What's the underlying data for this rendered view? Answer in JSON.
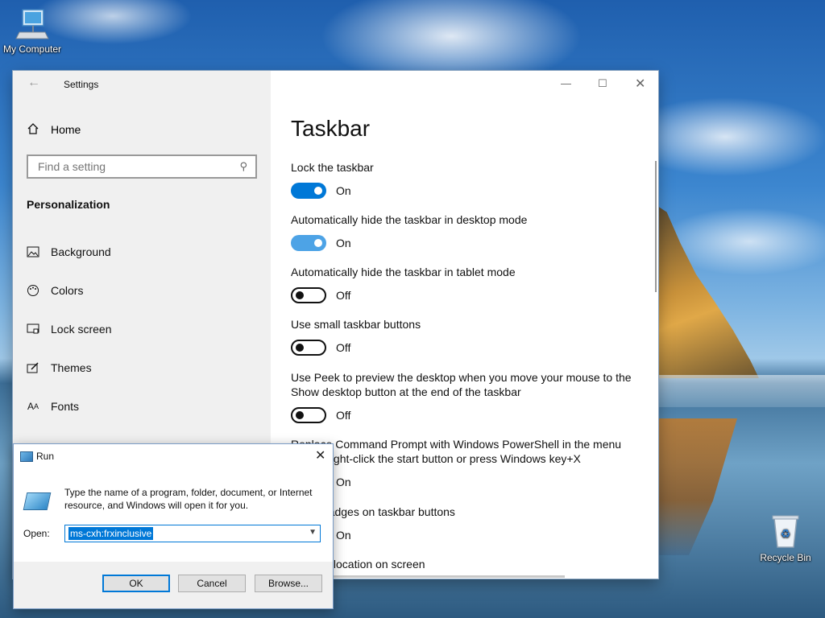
{
  "desktop": {
    "icons": [
      {
        "label": "My Computer",
        "icon": "computer-icon"
      },
      {
        "label": "Recycle Bin",
        "icon": "recycle-bin-icon"
      }
    ]
  },
  "settings": {
    "window_title": "Settings",
    "home_label": "Home",
    "search_placeholder": "Find a setting",
    "section_label": "Personalization",
    "nav_items": [
      {
        "label": "Background",
        "icon": "image-icon"
      },
      {
        "label": "Colors",
        "icon": "palette-icon"
      },
      {
        "label": "Lock screen",
        "icon": "lock-screen-icon"
      },
      {
        "label": "Themes",
        "icon": "themes-icon"
      },
      {
        "label": "Fonts",
        "icon": "fonts-icon"
      }
    ],
    "page_title": "Taskbar",
    "settings_list": [
      {
        "label": "Lock the taskbar",
        "state": "On"
      },
      {
        "label": "Automatically hide the taskbar in desktop mode",
        "state": "On"
      },
      {
        "label": "Automatically hide the taskbar in tablet mode",
        "state": "Off"
      },
      {
        "label": "Use small taskbar buttons",
        "state": "Off"
      },
      {
        "label": "Use Peek to preview the desktop when you move your mouse to the Show desktop button at the end of the taskbar",
        "state": "Off"
      },
      {
        "label": "Replace Command Prompt with Windows PowerShell in the menu when I right-click the start button or press Windows key+X",
        "state": "On"
      },
      {
        "label": "Show badges on taskbar buttons",
        "state": "On"
      },
      {
        "label": "Taskbar location on screen",
        "state": ""
      }
    ],
    "colors": {
      "accent": "#0078d7",
      "sidebar_bg": "#f0f0f0"
    }
  },
  "run_dialog": {
    "title": "Run",
    "description": "Type the name of a program, folder, document, or Internet resource, and Windows will open it for you.",
    "open_label": "Open:",
    "open_value": "ms-cxh:frxinclusive",
    "ok_label": "OK",
    "cancel_label": "Cancel",
    "browse_label": "Browse..."
  }
}
